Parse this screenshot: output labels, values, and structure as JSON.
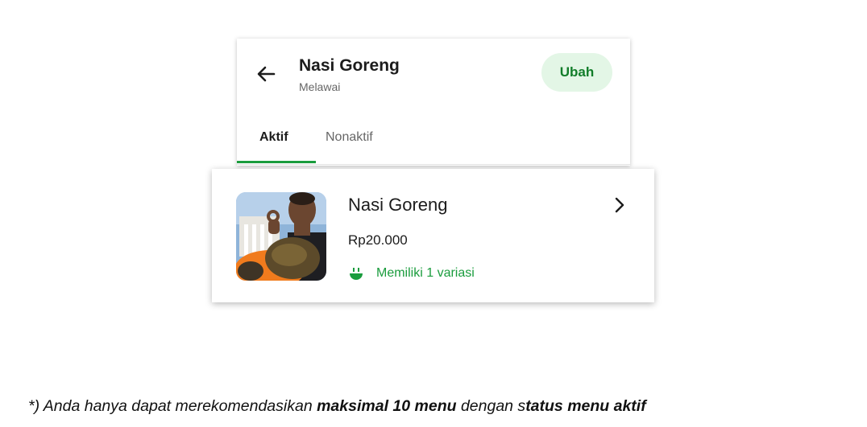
{
  "header": {
    "title": "Nasi Goreng",
    "subtitle": "Melawai",
    "edit_label": "Ubah",
    "back_icon": "arrow-left-icon"
  },
  "tabs": [
    {
      "label": "Aktif",
      "active": true
    },
    {
      "label": "Nonaktif",
      "active": false
    }
  ],
  "item": {
    "name": "Nasi Goreng",
    "price": "Rp20.000",
    "variant_label": "Memiliki 1 variasi",
    "variant_icon": "bowl-icon",
    "chevron_icon": "chevron-right-icon"
  },
  "footnote": {
    "part1": "*) Anda hanya dapat merekomendasikan ",
    "bold1": "maksimal 10 menu",
    "part2": " dengan s",
    "bold2": "tatus menu aktif"
  },
  "colors": {
    "accent_green": "#1a9c3d",
    "button_bg": "#e3f6e6",
    "button_text": "#127d2a"
  }
}
